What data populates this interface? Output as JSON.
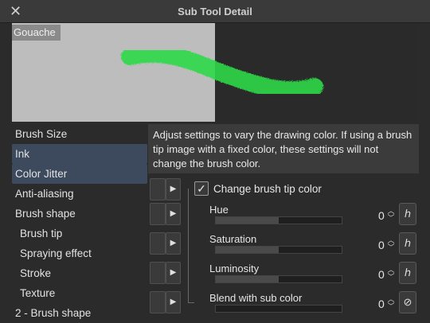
{
  "window": {
    "title": "Sub Tool Detail",
    "close_glyph": "✕"
  },
  "preview": {
    "label": "Gouache",
    "stroke_color": "#2fd94a"
  },
  "sidebar": {
    "items": [
      {
        "label": "Brush Size",
        "selected": false,
        "sub": false
      },
      {
        "label": "Ink",
        "selected": true,
        "sub": false
      },
      {
        "label": "Color Jitter",
        "selected": true,
        "sub": false
      },
      {
        "label": "Anti-aliasing",
        "selected": false,
        "sub": false
      },
      {
        "label": "Brush shape",
        "selected": false,
        "sub": false
      },
      {
        "label": "Brush tip",
        "selected": false,
        "sub": true
      },
      {
        "label": "Spraying effect",
        "selected": false,
        "sub": true
      },
      {
        "label": "Stroke",
        "selected": false,
        "sub": true
      },
      {
        "label": "Texture",
        "selected": false,
        "sub": true
      },
      {
        "label": "2 - Brush shape",
        "selected": false,
        "sub": false
      }
    ]
  },
  "description": "Adjust settings to vary the drawing color. If using a brush tip image with a fixed color, these settings will not change the brush color.",
  "change_tip_color": {
    "label": "Change brush tip color",
    "checked": true,
    "glyph": "✓"
  },
  "params": [
    {
      "label": "Hue",
      "value": "0",
      "level": 0.5
    },
    {
      "label": "Saturation",
      "value": "0",
      "level": 0.5
    },
    {
      "label": "Luminosity",
      "value": "0",
      "level": 0.5
    },
    {
      "label": "Blend with sub color",
      "value": "0",
      "level": 0
    }
  ],
  "icons": {
    "play": "▶",
    "pressure": "ℎ",
    "disabled": "⊘",
    "up": "︿",
    "down": "﹀"
  }
}
